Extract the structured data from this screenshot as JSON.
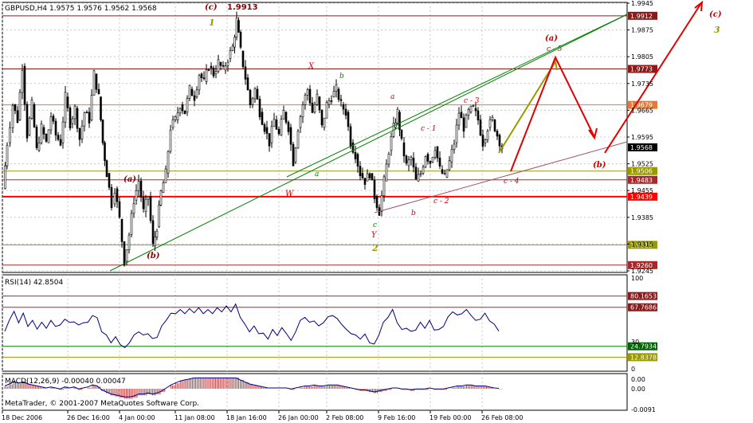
{
  "window": {
    "header": "GBPUSD,H4  1.9575 1.9576 1.9562 1.9568",
    "copyright": "MetaTrader, © 2001-2007 MetaQuotes Software Corp."
  },
  "colors": {
    "background": "#ffffff",
    "grid": "#c8c8c8",
    "candle": "#000000",
    "level_dark": "#8b1a1a",
    "level_orange": "#e07b39",
    "level_olive": "#999900",
    "level_red": "#ff0000",
    "level_darkred": "#a52a2a",
    "trend_green": "#008000",
    "trend_brown": "#a0526d",
    "arrow_red": "#e00000",
    "arrow_olive": "#999900",
    "rsi_line": "#000080",
    "rsi_level": "#b22222",
    "rsi_low_level": "#008000",
    "macd_hist": "#c04040",
    "macd_signal": "#000080"
  },
  "chart_data": [
    {
      "type": "candlestick",
      "symbol": "GBPUSD",
      "timeframe": "H4",
      "ohlc_current": {
        "open": 1.9575,
        "high": 1.9576,
        "low": 1.9562,
        "close": 1.9568
      },
      "ylim": [
        1.9245,
        1.9945
      ],
      "y_ticks": [
        "1.9945",
        "1.9875",
        "1.9805",
        "1.9735",
        "1.9665",
        "1.9595",
        "1.9525",
        "1.9455",
        "1.9385",
        "1.9315",
        "1.9245"
      ],
      "x_ticks": [
        "18 Dec 2006",
        "26 Dec 16:00",
        "4 Jan 00:00",
        "11 Jan 08:00",
        "18 Jan 16:00",
        "26 Jan 00:00",
        "2 Feb 08:00",
        "9 Feb 16:00",
        "19 Feb 00:00",
        "26 Feb 08:00"
      ],
      "close_path": [
        [
          0,
          1.946
        ],
        [
          5,
          1.958
        ],
        [
          12,
          1.968
        ],
        [
          18,
          1.964
        ],
        [
          24,
          1.978
        ],
        [
          30,
          1.96
        ],
        [
          36,
          1.968
        ],
        [
          42,
          1.956
        ],
        [
          48,
          1.962
        ],
        [
          54,
          1.958
        ],
        [
          60,
          1.965
        ],
        [
          66,
          1.96
        ],
        [
          72,
          1.958
        ],
        [
          78,
          1.97
        ],
        [
          84,
          1.963
        ],
        [
          90,
          1.967
        ],
        [
          96,
          1.959
        ],
        [
          102,
          1.966
        ],
        [
          108,
          1.964
        ],
        [
          114,
          1.976
        ],
        [
          120,
          1.97
        ],
        [
          125,
          1.958
        ],
        [
          130,
          1.95
        ],
        [
          136,
          1.942
        ],
        [
          140,
          1.946
        ],
        [
          146,
          1.938
        ],
        [
          152,
          1.927
        ],
        [
          158,
          1.934
        ],
        [
          164,
          1.943
        ],
        [
          170,
          1.948
        ],
        [
          176,
          1.94
        ],
        [
          182,
          1.944
        ],
        [
          188,
          1.931
        ],
        [
          193,
          1.936
        ],
        [
          198,
          1.945
        ],
        [
          204,
          1.95
        ],
        [
          210,
          1.962
        ],
        [
          216,
          1.964
        ],
        [
          222,
          1.968
        ],
        [
          228,
          1.966
        ],
        [
          234,
          1.972
        ],
        [
          240,
          1.97
        ],
        [
          246,
          1.976
        ],
        [
          252,
          1.974
        ],
        [
          258,
          1.978
        ],
        [
          264,
          1.976
        ],
        [
          270,
          1.979
        ],
        [
          276,
          1.977
        ],
        [
          282,
          1.98
        ],
        [
          288,
          1.983
        ],
        [
          293,
          1.99
        ],
        [
          298,
          1.982
        ],
        [
          304,
          1.975
        ],
        [
          310,
          1.968
        ],
        [
          316,
          1.972
        ],
        [
          322,
          1.966
        ],
        [
          328,
          1.962
        ],
        [
          334,
          1.958
        ],
        [
          340,
          1.964
        ],
        [
          346,
          1.96
        ],
        [
          352,
          1.966
        ],
        [
          358,
          1.962
        ],
        [
          364,
          1.953
        ],
        [
          370,
          1.962
        ],
        [
          376,
          1.968
        ],
        [
          382,
          1.972
        ],
        [
          388,
          1.966
        ],
        [
          394,
          1.97
        ],
        [
          400,
          1.962
        ],
        [
          406,
          1.968
        ],
        [
          412,
          1.97
        ],
        [
          418,
          1.972
        ],
        [
          424,
          1.968
        ],
        [
          430,
          1.966
        ],
        [
          436,
          1.958
        ],
        [
          442,
          1.955
        ],
        [
          448,
          1.95
        ],
        [
          454,
          1.948
        ],
        [
          460,
          1.95
        ],
        [
          466,
          1.944
        ],
        [
          472,
          1.94
        ],
        [
          478,
          1.948
        ],
        [
          484,
          1.956
        ],
        [
          490,
          1.962
        ],
        [
          495,
          1.966
        ],
        [
          500,
          1.958
        ],
        [
          506,
          1.952
        ],
        [
          512,
          1.954
        ],
        [
          518,
          1.948
        ],
        [
          524,
          1.95
        ],
        [
          530,
          1.955
        ],
        [
          536,
          1.953
        ],
        [
          542,
          1.957
        ],
        [
          548,
          1.951
        ],
        [
          554,
          1.949
        ],
        [
          560,
          1.953
        ],
        [
          566,
          1.958
        ],
        [
          572,
          1.966
        ],
        [
          578,
          1.962
        ],
        [
          584,
          1.966
        ],
        [
          590,
          1.967
        ],
        [
          596,
          1.964
        ],
        [
          602,
          1.958
        ],
        [
          608,
          1.962
        ],
        [
          614,
          1.964
        ],
        [
          620,
          1.96
        ],
        [
          626,
          1.9568
        ]
      ],
      "levels": [
        {
          "value": 1.9912,
          "label": "1.9912",
          "color": "dark"
        },
        {
          "value": 1.9773,
          "label": "1.9773",
          "color": "dark"
        },
        {
          "value": 1.9679,
          "label": "1.9679",
          "color": "orange"
        },
        {
          "value": 1.9568,
          "label": "1.9568",
          "color": "current"
        },
        {
          "value": 1.9506,
          "label": "1.9506",
          "color": "olive"
        },
        {
          "value": 1.9483,
          "label": "1.9483",
          "color": "darkred"
        },
        {
          "value": 1.9439,
          "label": "1.9439",
          "color": "red"
        },
        {
          "value": 1.9313,
          "label": "1.9313",
          "color": "olive"
        },
        {
          "value": 1.926,
          "label": "1.9260",
          "color": "darkred"
        }
      ],
      "wave_labels": [
        "(c)",
        "1.9913",
        "1",
        "(a)",
        "(b)",
        "X",
        "b",
        "a",
        "W",
        "a",
        "c - 1",
        "c - 3",
        "b",
        "c - 2",
        "c - 4",
        "c",
        "Y",
        "2",
        "(a)",
        "c - 5",
        "(b)",
        "(c)",
        "3"
      ]
    },
    {
      "type": "line",
      "name": "RSI(14) 42.8504",
      "ylim": [
        0,
        100
      ],
      "y_ticks": [
        "100",
        "30",
        "0"
      ],
      "levels": [
        {
          "value": 80.1653,
          "label": "80.1653"
        },
        {
          "value": 67.7686,
          "label": "67.7686"
        },
        {
          "value": 24.7934,
          "label": "24.7934"
        },
        {
          "value": 12.8378,
          "label": "12.8378"
        }
      ],
      "values": [
        40,
        55,
        62,
        52,
        60,
        48,
        52,
        45,
        50,
        46,
        52,
        48,
        47,
        56,
        50,
        53,
        47,
        52,
        50,
        60,
        55,
        42,
        36,
        30,
        34,
        28,
        22,
        30,
        36,
        42,
        36,
        40,
        32,
        36,
        46,
        55,
        60,
        62,
        64,
        62,
        65,
        63,
        66,
        62,
        64,
        62,
        66,
        64,
        68,
        64,
        70,
        58,
        48,
        42,
        46,
        40,
        38,
        34,
        42,
        38,
        44,
        40,
        30,
        42,
        52,
        58,
        50,
        54,
        46,
        52,
        56,
        60,
        54,
        50,
        42,
        40,
        36,
        34,
        37,
        30,
        26,
        38,
        50,
        58,
        64,
        52,
        42,
        46,
        40,
        44,
        50,
        46,
        52,
        44,
        42,
        48,
        56,
        64,
        58,
        62,
        64,
        60,
        52,
        56,
        60,
        54,
        48,
        42.85
      ]
    },
    {
      "type": "bar",
      "name": "MACD(12,26,9) -0.00040 0.00047",
      "ylim": [
        -0.0091,
        0.0098
      ],
      "y_ticks": [
        "0.00",
        "0.00",
        "-0.0091"
      ],
      "values": [
        0.2,
        0.4,
        0.6,
        0.5,
        0.6,
        0.4,
        0.3,
        0.2,
        0.1,
        0.0,
        0.1,
        0.0,
        -0.1,
        0.1,
        0.0,
        0.1,
        -0.1,
        0.0,
        0.1,
        0.3,
        0.2,
        -0.2,
        -0.4,
        -0.6,
        -0.7,
        -0.8,
        -0.9,
        -0.9,
        -0.8,
        -0.6,
        -0.6,
        -0.5,
        -0.6,
        -0.5,
        -0.3,
        0.0,
        0.3,
        0.5,
        0.7,
        0.8,
        0.9,
        1.0,
        1.0,
        1.0,
        1.0,
        1.0,
        1.0,
        1.0,
        1.0,
        1.0,
        1.0,
        0.8,
        0.6,
        0.4,
        0.3,
        0.2,
        0.1,
        0.0,
        0.0,
        0.0,
        0.0,
        0.0,
        -0.1,
        0.0,
        0.1,
        0.2,
        0.2,
        0.3,
        0.2,
        0.2,
        0.3,
        0.3,
        0.3,
        0.2,
        0.1,
        0.0,
        -0.1,
        -0.2,
        -0.2,
        -0.3,
        -0.4,
        -0.3,
        -0.2,
        -0.1,
        0.0,
        0.0,
        -0.1,
        -0.1,
        -0.2,
        -0.1,
        -0.1,
        -0.1,
        0.0,
        -0.1,
        -0.1,
        -0.1,
        0.0,
        0.1,
        0.2,
        0.2,
        0.3,
        0.3,
        0.2,
        0.2,
        0.2,
        0.1,
        0.0,
        -0.04
      ]
    }
  ]
}
